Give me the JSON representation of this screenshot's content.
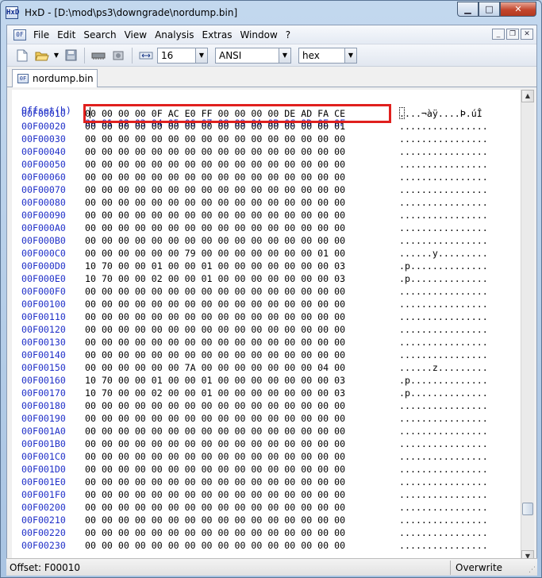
{
  "window": {
    "title": "HxD - [D:\\mod\\ps3\\downgrade\\nordump.bin]",
    "app_icon_glyph": "HxD",
    "minimize_glyph": "▁",
    "maximize_glyph": "□",
    "close_glyph": "✕"
  },
  "menu": {
    "items": [
      "File",
      "Edit",
      "Search",
      "View",
      "Analysis",
      "Extras",
      "Window",
      "?"
    ]
  },
  "toolbar": {
    "bytes_per_row": "16",
    "charset": "ANSI",
    "offset_base": "hex"
  },
  "tab": {
    "label": "nordump.bin"
  },
  "editor": {
    "header": {
      "offset_label": "Offset(h)",
      "columns": "00 01 02 03 04 05 06 07 08 09 0A 0B 0C 0D 0E 0F"
    },
    "rows": [
      {
        "offset": "00F00010",
        "hex": "00 00 00 00 0F AC E0 FF 00 00 00 00 DE AD FA CE",
        "ascii": "....¬àÿ....Þ.úÎ"
      },
      {
        "offset": "00F00020",
        "hex": "00 00 00 00 00 00 00 00 00 00 00 00 00 00 00 01",
        "ascii": "................"
      },
      {
        "offset": "00F00030",
        "hex": "00 00 00 00 00 00 00 00 00 00 00 00 00 00 00 00",
        "ascii": "................"
      },
      {
        "offset": "00F00040",
        "hex": "00 00 00 00 00 00 00 00 00 00 00 00 00 00 00 00",
        "ascii": "................"
      },
      {
        "offset": "00F00050",
        "hex": "00 00 00 00 00 00 00 00 00 00 00 00 00 00 00 00",
        "ascii": "................"
      },
      {
        "offset": "00F00060",
        "hex": "00 00 00 00 00 00 00 00 00 00 00 00 00 00 00 00",
        "ascii": "................"
      },
      {
        "offset": "00F00070",
        "hex": "00 00 00 00 00 00 00 00 00 00 00 00 00 00 00 00",
        "ascii": "................"
      },
      {
        "offset": "00F00080",
        "hex": "00 00 00 00 00 00 00 00 00 00 00 00 00 00 00 00",
        "ascii": "................"
      },
      {
        "offset": "00F00090",
        "hex": "00 00 00 00 00 00 00 00 00 00 00 00 00 00 00 00",
        "ascii": "................"
      },
      {
        "offset": "00F000A0",
        "hex": "00 00 00 00 00 00 00 00 00 00 00 00 00 00 00 00",
        "ascii": "................"
      },
      {
        "offset": "00F000B0",
        "hex": "00 00 00 00 00 00 00 00 00 00 00 00 00 00 00 00",
        "ascii": "................"
      },
      {
        "offset": "00F000C0",
        "hex": "00 00 00 00 00 00 79 00 00 00 00 00 00 00 01 00",
        "ascii": "......y........."
      },
      {
        "offset": "00F000D0",
        "hex": "10 70 00 00 01 00 00 01 00 00 00 00 00 00 00 03",
        "ascii": ".p.............."
      },
      {
        "offset": "00F000E0",
        "hex": "10 70 00 00 02 00 00 01 00 00 00 00 00 00 00 03",
        "ascii": ".p.............."
      },
      {
        "offset": "00F000F0",
        "hex": "00 00 00 00 00 00 00 00 00 00 00 00 00 00 00 00",
        "ascii": "................"
      },
      {
        "offset": "00F00100",
        "hex": "00 00 00 00 00 00 00 00 00 00 00 00 00 00 00 00",
        "ascii": "................"
      },
      {
        "offset": "00F00110",
        "hex": "00 00 00 00 00 00 00 00 00 00 00 00 00 00 00 00",
        "ascii": "................"
      },
      {
        "offset": "00F00120",
        "hex": "00 00 00 00 00 00 00 00 00 00 00 00 00 00 00 00",
        "ascii": "................"
      },
      {
        "offset": "00F00130",
        "hex": "00 00 00 00 00 00 00 00 00 00 00 00 00 00 00 00",
        "ascii": "................"
      },
      {
        "offset": "00F00140",
        "hex": "00 00 00 00 00 00 00 00 00 00 00 00 00 00 00 00",
        "ascii": "................"
      },
      {
        "offset": "00F00150",
        "hex": "00 00 00 00 00 00 7A 00 00 00 00 00 00 00 04 00",
        "ascii": "......z........."
      },
      {
        "offset": "00F00160",
        "hex": "10 70 00 00 01 00 00 01 00 00 00 00 00 00 00 03",
        "ascii": ".p.............."
      },
      {
        "offset": "00F00170",
        "hex": "10 70 00 00 02 00 00 01 00 00 00 00 00 00 00 03",
        "ascii": ".p.............."
      },
      {
        "offset": "00F00180",
        "hex": "00 00 00 00 00 00 00 00 00 00 00 00 00 00 00 00",
        "ascii": "................"
      },
      {
        "offset": "00F00190",
        "hex": "00 00 00 00 00 00 00 00 00 00 00 00 00 00 00 00",
        "ascii": "................"
      },
      {
        "offset": "00F001A0",
        "hex": "00 00 00 00 00 00 00 00 00 00 00 00 00 00 00 00",
        "ascii": "................"
      },
      {
        "offset": "00F001B0",
        "hex": "00 00 00 00 00 00 00 00 00 00 00 00 00 00 00 00",
        "ascii": "................"
      },
      {
        "offset": "00F001C0",
        "hex": "00 00 00 00 00 00 00 00 00 00 00 00 00 00 00 00",
        "ascii": "................"
      },
      {
        "offset": "00F001D0",
        "hex": "00 00 00 00 00 00 00 00 00 00 00 00 00 00 00 00",
        "ascii": "................"
      },
      {
        "offset": "00F001E0",
        "hex": "00 00 00 00 00 00 00 00 00 00 00 00 00 00 00 00",
        "ascii": "................"
      },
      {
        "offset": "00F001F0",
        "hex": "00 00 00 00 00 00 00 00 00 00 00 00 00 00 00 00",
        "ascii": "................"
      },
      {
        "offset": "00F00200",
        "hex": "00 00 00 00 00 00 00 00 00 00 00 00 00 00 00 00",
        "ascii": "................"
      },
      {
        "offset": "00F00210",
        "hex": "00 00 00 00 00 00 00 00 00 00 00 00 00 00 00 00",
        "ascii": "................"
      },
      {
        "offset": "00F00220",
        "hex": "00 00 00 00 00 00 00 00 00 00 00 00 00 00 00 00",
        "ascii": "................"
      },
      {
        "offset": "00F00230",
        "hex": "00 00 00 00 00 00 00 00 00 00 00 00 00 00 00 00",
        "ascii": "................"
      }
    ],
    "highlight_color": "#e0201e"
  },
  "status": {
    "offset": "Offset: F00010",
    "mode": "Overwrite"
  },
  "icons": {
    "new": "new-file-icon",
    "open": "open-folder-icon",
    "save": "save-icon",
    "ram": "memory-icon",
    "disk": "disk-icon",
    "width": "row-width-icon"
  }
}
